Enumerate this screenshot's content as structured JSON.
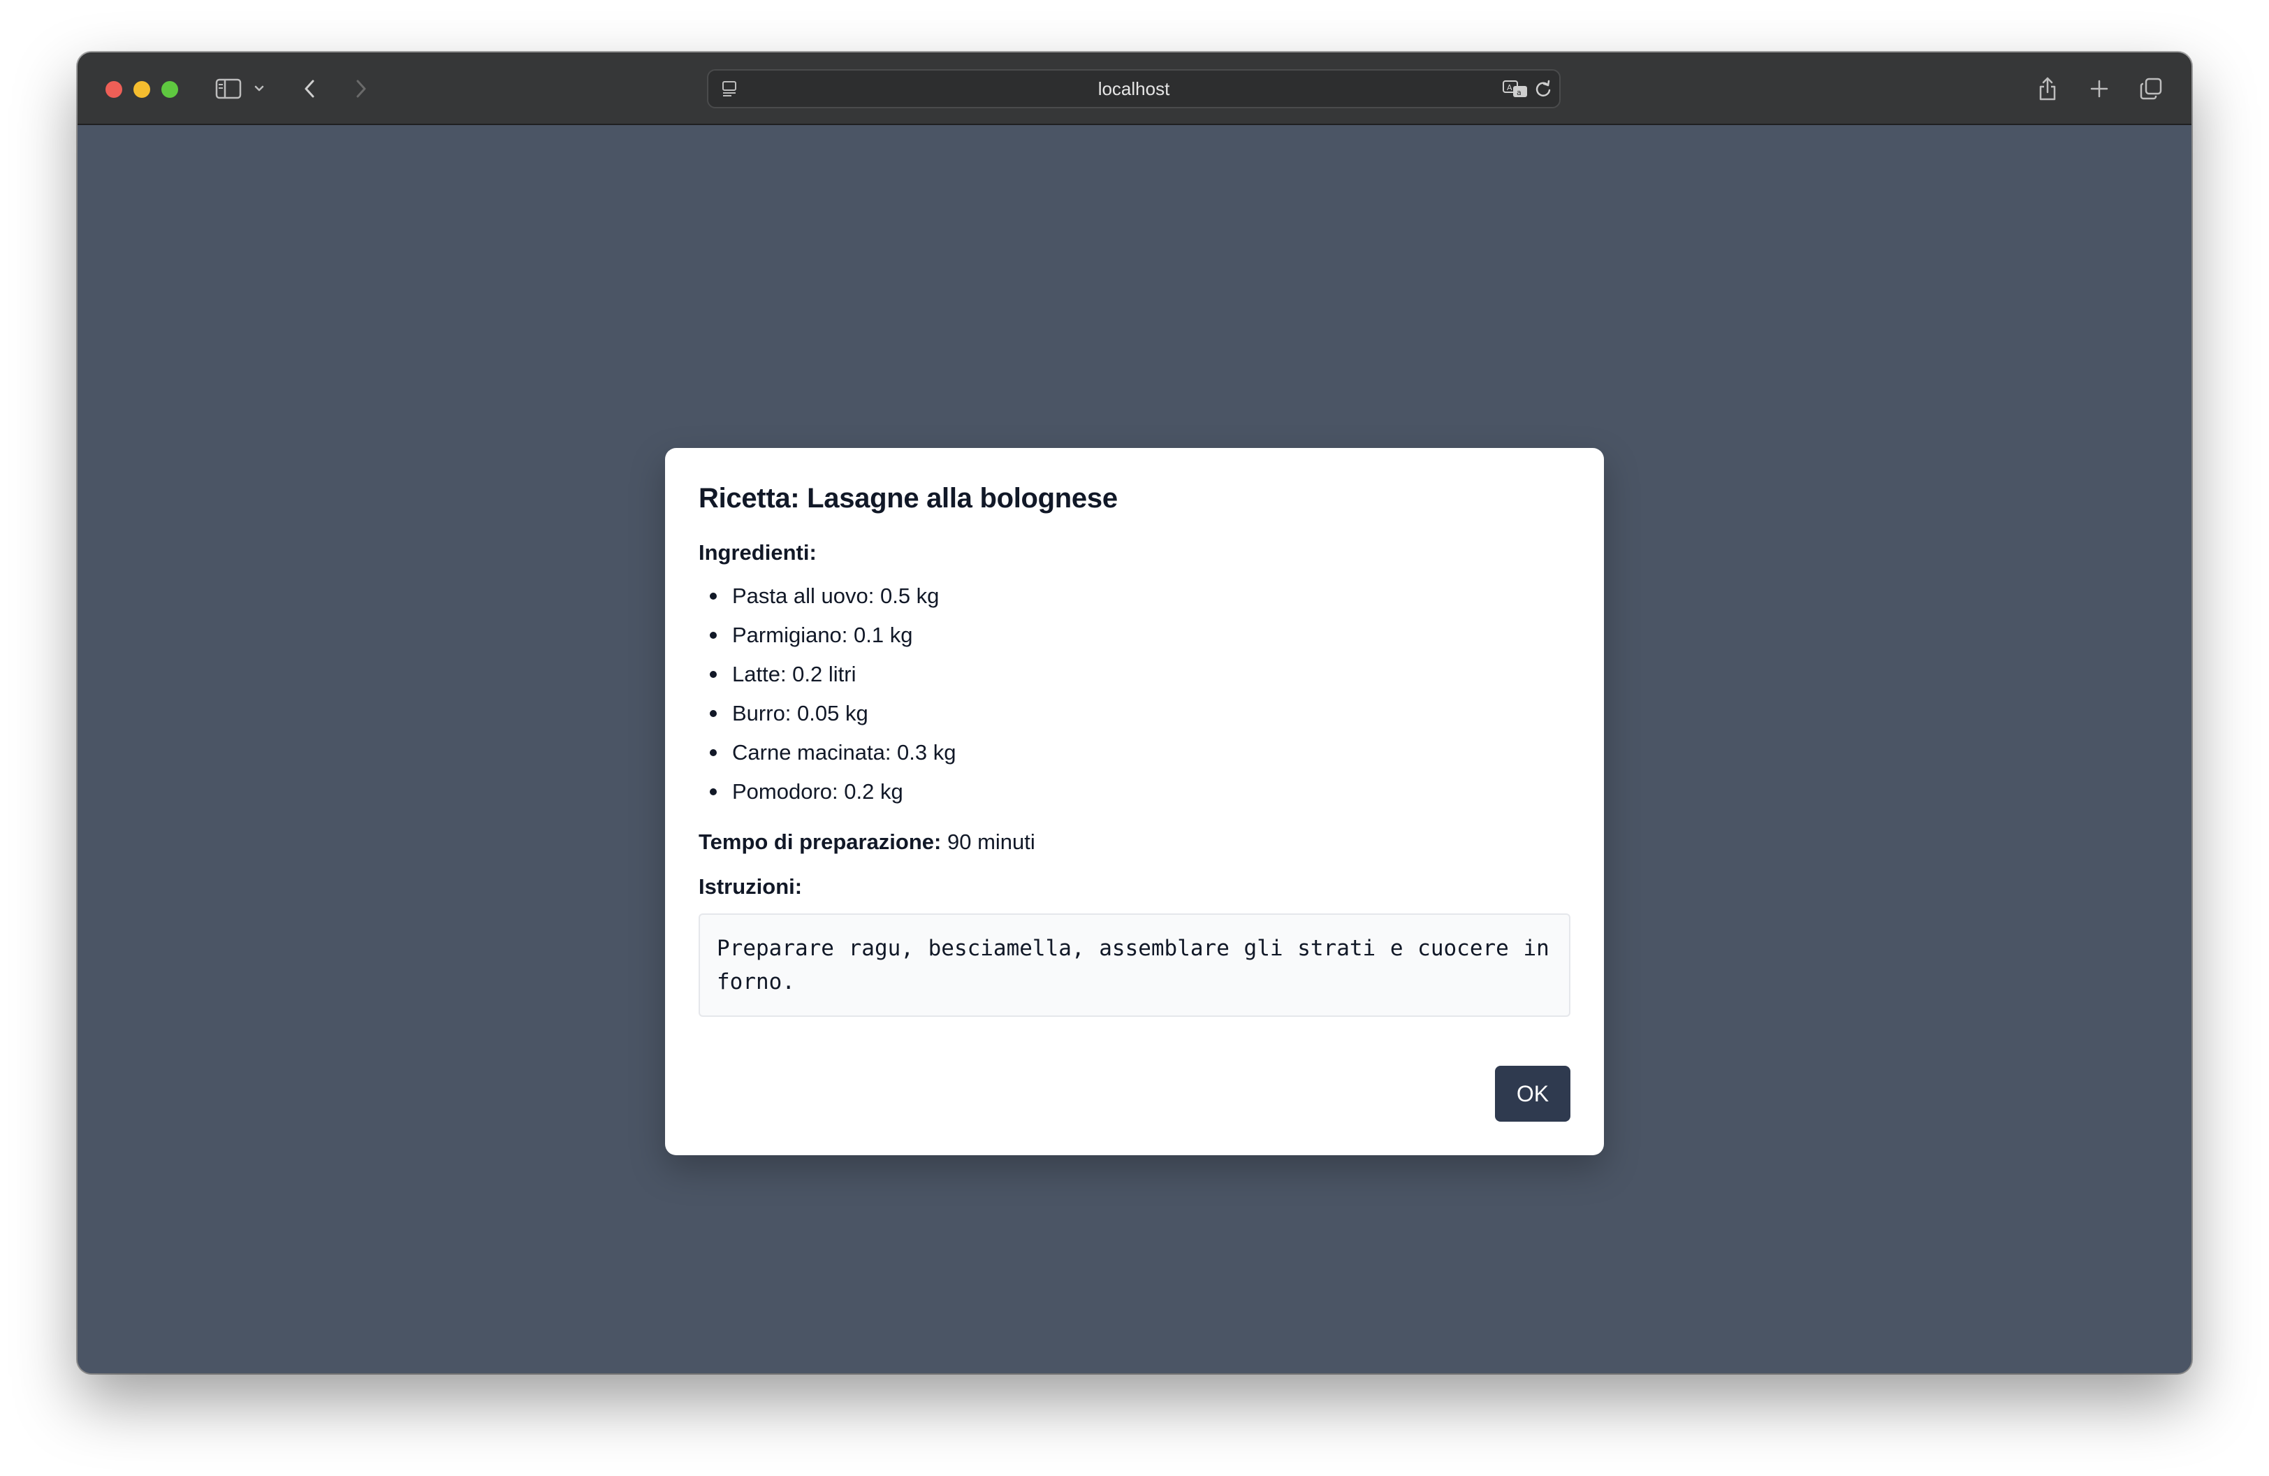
{
  "browser": {
    "address": "localhost",
    "icons": {
      "sidebar": "sidebar-icon",
      "dropdown": "chevron-down-icon",
      "back": "back-arrow-icon",
      "forward": "forward-arrow-icon",
      "page_menu": "page-menu-icon",
      "translate": "translate-icon",
      "reload": "reload-icon",
      "share": "share-icon",
      "new_tab": "plus-icon",
      "tabs": "tab-overview-icon"
    }
  },
  "dialog": {
    "title": "Ricetta: Lasagne alla bolognese",
    "ingredients_label": "Ingredienti:",
    "ingredients": [
      "Pasta all uovo: 0.5 kg",
      "Parmigiano: 0.1 kg",
      "Latte: 0.2 litri",
      "Burro: 0.05 kg",
      "Carne macinata: 0.3 kg",
      "Pomodoro: 0.2 kg"
    ],
    "prep_label": "Tempo di preparazione:",
    "prep_value": "90 minuti",
    "instructions_label": "Istruzioni:",
    "instructions": "Preparare ragu, besciamella, assemblare gli strati e cuocere in forno.",
    "ok_label": "OK"
  },
  "colors": {
    "page_background": "#4b5565",
    "ok_button": "#2f3a4f",
    "toolbar": "#363738"
  }
}
